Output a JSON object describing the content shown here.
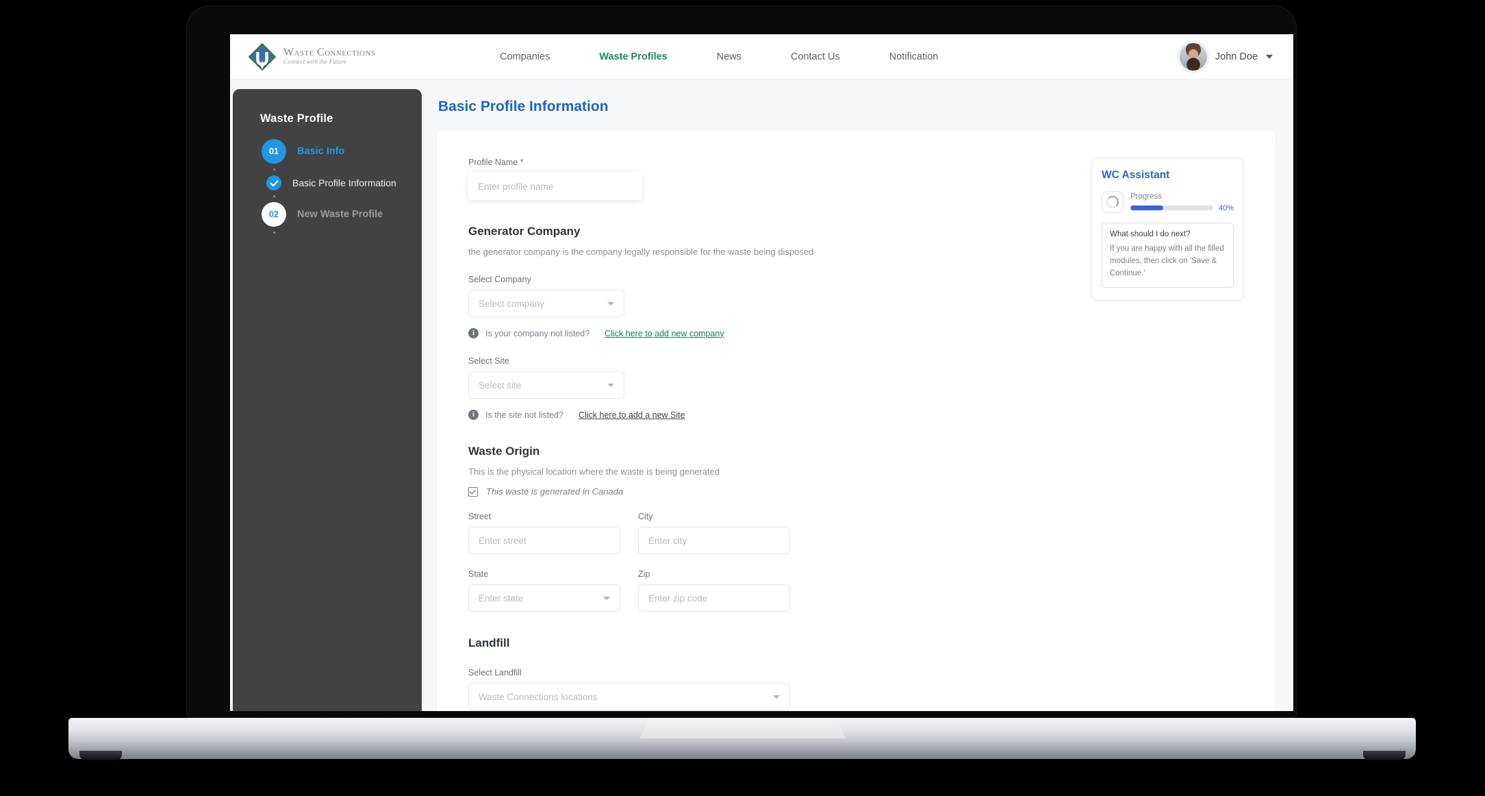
{
  "brand": {
    "title": "Waste Connections",
    "tagline": "Connect with the Future",
    "logo_icon": "waste-connections-diamond-logo"
  },
  "nav": {
    "items": [
      {
        "label": "Companies",
        "active": false
      },
      {
        "label": "Waste Profiles",
        "active": true
      },
      {
        "label": "News",
        "active": false
      },
      {
        "label": "Contact Us",
        "active": false
      },
      {
        "label": "Notification",
        "active": false
      }
    ],
    "active_color": "#1b8a5a"
  },
  "user": {
    "name": "John Doe",
    "avatar_icon": "user-avatar-photo",
    "caret_icon": "chevron-down-icon"
  },
  "sidebar": {
    "title": "Waste Profile",
    "steps": [
      {
        "number": "01",
        "label": "Basic Info",
        "state": "active"
      },
      {
        "check_icon": "check-circle-icon",
        "label": "Basic Profile Information",
        "state": "completed"
      },
      {
        "number": "02",
        "label": "New Waste Profile",
        "state": "upcoming"
      }
    ],
    "background": "#424242",
    "accent": "#2196e3"
  },
  "main": {
    "page_title": "Basic Profile Information",
    "profile_name": {
      "label": "Profile Name *",
      "placeholder": "Enter profile name",
      "value": ""
    },
    "generator_company": {
      "title": "Generator Company",
      "description": "the generator company is the company legally responsible for the waste being disposed",
      "select_company_label": "Select Company",
      "select_company_placeholder": "Select company",
      "hint_text": "Is your company not listed?",
      "hint_link": "Click here to add new company",
      "hint_icon": "info-icon"
    },
    "select_site": {
      "label": "Select Site",
      "placeholder": "Select site",
      "hint_text": "Is the site not listed?",
      "hint_link": "Click here to add a new Site",
      "hint_icon": "info-icon"
    },
    "waste_origin": {
      "title": "Waste Origin",
      "description": "This is the physical location where the waste is being generated",
      "checkbox_label": "This waste is generated in Canada",
      "checkbox_checked": true,
      "street_label": "Street",
      "street_placeholder": "Enter street",
      "city_label": "City",
      "city_placeholder": "Enter city",
      "state_label": "State",
      "state_placeholder": "Enter state",
      "zip_label": "Zip",
      "zip_placeholder": "Enter zip code"
    },
    "landfill": {
      "title": "Landfill",
      "select_label": "Select Landfill",
      "select_placeholder": "Waste Connections locations"
    }
  },
  "assistant": {
    "title": "WC Assistant",
    "spinner_icon": "loading-spinner-icon",
    "progress_label": "Progress",
    "progress_percent": "40%",
    "progress_value": 40,
    "progress_color": "#3b63d3",
    "message_question": "What should I do next?",
    "message_answer": "If you are happy with all the filled modules, then click on 'Save & Continue.'"
  }
}
